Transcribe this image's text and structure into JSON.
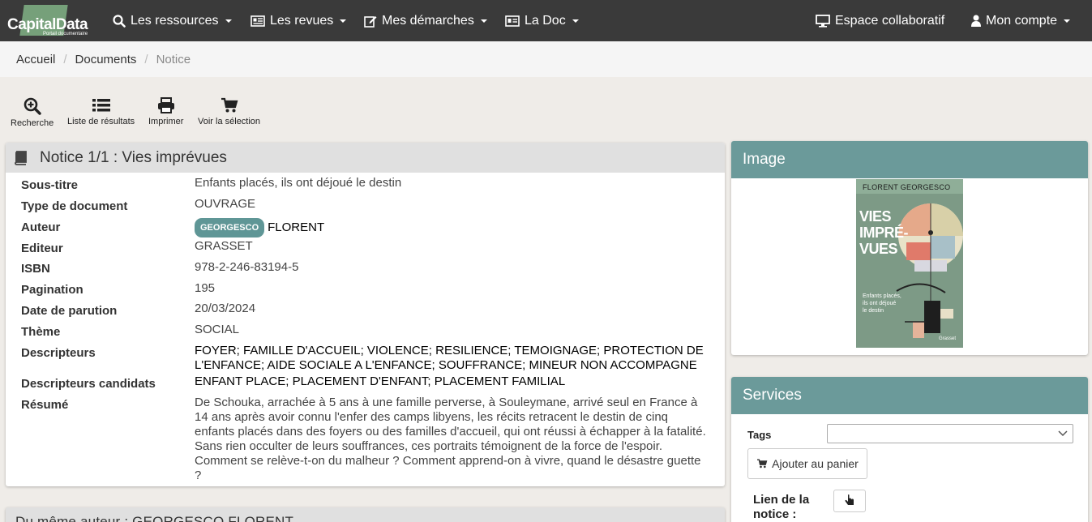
{
  "brand": {
    "name": "CapitalData",
    "tagline": "Portail documentaire"
  },
  "nav": {
    "ressources": "Les ressources",
    "revues": "Les revues",
    "demarches": "Mes démarches",
    "doc": "La Doc",
    "espace": "Espace collaboratif",
    "compte": "Mon compte"
  },
  "breadcrumb": [
    "Accueil",
    "Documents",
    "Notice"
  ],
  "toolbar": {
    "recherche": "Recherche",
    "liste": "Liste de résultats",
    "imprimer": "Imprimer",
    "selection": "Voir la sélection"
  },
  "notice": {
    "title": "Notice 1/1 : Vies imprévues",
    "fields": {
      "sous_titre": {
        "label": "Sous-titre",
        "value": "Enfants placés, ils ont déjoué le destin"
      },
      "type": {
        "label": "Type de document",
        "value": "OUVRAGE"
      },
      "auteur": {
        "label": "Auteur",
        "badge": "GEORGESCO",
        "value": "FLORENT"
      },
      "editeur": {
        "label": "Editeur",
        "value": "GRASSET"
      },
      "isbn": {
        "label": "ISBN",
        "value": "978-2-246-83194-5"
      },
      "pagination": {
        "label": "Pagination",
        "value": "195"
      },
      "date": {
        "label": "Date de parution",
        "value": "20/03/2024"
      },
      "theme": {
        "label": "Thème",
        "value": "SOCIAL"
      },
      "descripteurs": {
        "label": "Descripteurs",
        "value": "FOYER; FAMILLE D'ACCUEIL; VIOLENCE; RESILIENCE; TEMOIGNAGE; PROTECTION DE L'ENFANCE; AIDE SOCIALE A L'ENFANCE; SOUFFRANCE; MINEUR NON ACCOMPAGNE"
      },
      "descripteurs_candidats": {
        "label": "Descripteurs candidats",
        "value": "ENFANT PLACE; PLACEMENT D'ENFANT; PLACEMENT FAMILIAL"
      },
      "resume": {
        "label": "Résumé",
        "value": "De Schouka, arrachée à 5 ans à une famille perverse, à Souleymane, arrivé seul en France à 14 ans après avoir connu l'enfer des camps libyens, les récits retracent le destin de cinq enfants placés dans des foyers ou des familles d'accueil, qui ont réussi à échapper à la fatalité. Sans rien occulter de leurs souffrances, ces portraits témoignent de la force de l'espoir. Comment se relève-t-on du malheur ? Comment apprend-on à vivre, quand le désastre guette ?"
      }
    }
  },
  "bottom_panel": {
    "title": "Du même auteur : GEORGESCO FLORENT"
  },
  "image_panel": {
    "title": "Image",
    "cover": {
      "author": "FLORENT GEORGESCO",
      "title_lines": [
        "VIES",
        "IMPRÉ-",
        "VUES"
      ],
      "subtitle_lines": [
        "Enfants placés,",
        "ils ont déjoué",
        "le destin"
      ],
      "publisher": "Grasset"
    }
  },
  "services": {
    "title": "Services",
    "tags_label": "Tags",
    "tags_value": "",
    "cart_button": "Ajouter au panier",
    "lien_label": "Lien de la notice :"
  }
}
